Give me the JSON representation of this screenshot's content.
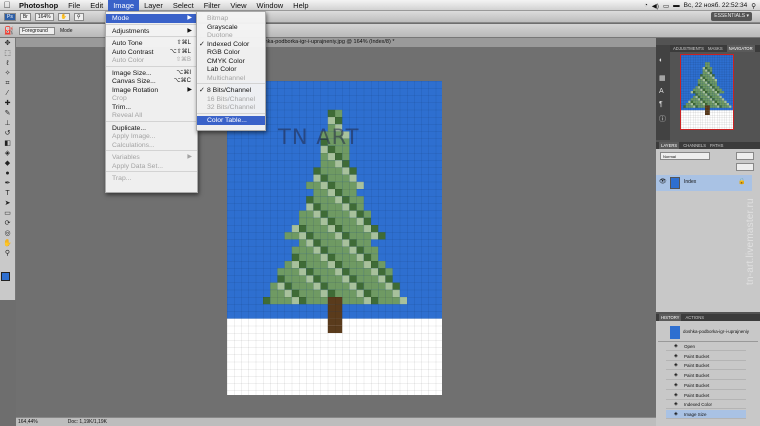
{
  "menubar": {
    "app": "Photoshop",
    "items": [
      "File",
      "Edit",
      "Image",
      "Layer",
      "Select",
      "Filter",
      "View",
      "Window",
      "Help"
    ],
    "active": "Image",
    "clock": "Вс, 22 нояб.  22:52:34"
  },
  "optbar": {
    "zoom": "164%",
    "essentials": "ESSENTIALS ▾"
  },
  "toolopt": {
    "preset": "Foreground",
    "mode_label": "Mode"
  },
  "document": {
    "tab_title": "...hka-podborka-igr-i-uprajneniy.jpg @ 164% (Index/8) *",
    "watermark": "TN  ART"
  },
  "status": {
    "zoom": "164,44%",
    "doc": "Doc: 1,19K/1,19K"
  },
  "image_menu": [
    {
      "label": "Mode",
      "arrow": true,
      "highlight": true
    },
    {
      "sep": true
    },
    {
      "label": "Adjustments",
      "arrow": true
    },
    {
      "sep": true
    },
    {
      "label": "Auto Tone",
      "shortcut": "⇧⌘L"
    },
    {
      "label": "Auto Contrast",
      "shortcut": "⌥⇧⌘L"
    },
    {
      "label": "Auto Color",
      "shortcut": "⇧⌘B",
      "disabled": true
    },
    {
      "sep": true
    },
    {
      "label": "Image Size...",
      "shortcut": "⌥⌘I"
    },
    {
      "label": "Canvas Size...",
      "shortcut": "⌥⌘C"
    },
    {
      "label": "Image Rotation",
      "arrow": true
    },
    {
      "label": "Crop",
      "disabled": true
    },
    {
      "label": "Trim..."
    },
    {
      "label": "Reveal All",
      "disabled": true
    },
    {
      "sep": true
    },
    {
      "label": "Duplicate..."
    },
    {
      "label": "Apply Image...",
      "disabled": true
    },
    {
      "label": "Calculations...",
      "disabled": true
    },
    {
      "sep": true
    },
    {
      "label": "Variables",
      "arrow": true,
      "disabled": true
    },
    {
      "label": "Apply Data Set...",
      "disabled": true
    },
    {
      "sep": true
    },
    {
      "label": "Trap...",
      "disabled": true
    }
  ],
  "mode_menu": [
    {
      "label": "Bitmap",
      "disabled": true
    },
    {
      "label": "Grayscale"
    },
    {
      "label": "Duotone",
      "disabled": true
    },
    {
      "label": "Indexed Color",
      "checked": true
    },
    {
      "label": "RGB Color"
    },
    {
      "label": "CMYK Color"
    },
    {
      "label": "Lab Color"
    },
    {
      "label": "Multichannel",
      "disabled": true
    },
    {
      "sep": true
    },
    {
      "label": "8 Bits/Channel",
      "checked": true
    },
    {
      "label": "16 Bits/Channel",
      "disabled": true
    },
    {
      "label": "32 Bits/Channel",
      "disabled": true
    },
    {
      "sep": true
    },
    {
      "label": "Color Table...",
      "highlight": true
    }
  ],
  "panels": {
    "nav_tabs": [
      "ADJUSTMENTS",
      "MASKS",
      "NAVIGATOR"
    ],
    "layer_tabs": [
      "LAYERS",
      "CHANNELS",
      "PATHS"
    ],
    "layer_mode": "Normal",
    "layer_name": "Index",
    "history_tabs": [
      "HISTORY",
      "ACTIONS"
    ],
    "history_snapshot": "doshka-podborka-igr-i-uprajneniy",
    "history": [
      "Open",
      "Paint Bucket",
      "Paint Bucket",
      "Paint Bucket",
      "Paint Bucket",
      "Paint Bucket",
      "Indexed Color",
      "Image Size"
    ]
  },
  "watermark_site": "tn-art.livemaster.ru",
  "colors": {
    "sky": "#2e6fd0",
    "snow": "#ffffff",
    "tree_light": "#6f9a63",
    "tree_dark": "#3f6b36",
    "trunk": "#5a3b1c",
    "highlight": "#3a62c9"
  }
}
